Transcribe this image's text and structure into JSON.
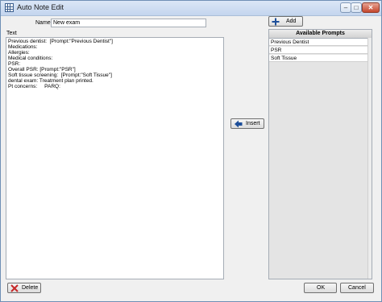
{
  "window": {
    "title": "Auto Note Edit",
    "minimize_glyph": "–",
    "maximize_glyph": "□",
    "close_glyph": "✕"
  },
  "form": {
    "name_label": "Name",
    "name_value": "New exam",
    "text_label": "Text",
    "text_lines": [
      "Previous dentist:  [Prompt:\"Previous Dentist\"]",
      "Medications:",
      "Allergies:",
      "Medical conditions:",
      "PSR:",
      "Overall PSR: [Prompt:\"PSR\"]",
      "Soft tissue screening:  [Prompt:\"Soft Tissue\"]",
      "dental exam: Treatment plan printed.",
      "Pt concerns:     PARQ:"
    ]
  },
  "buttons": {
    "add": "Add",
    "insert": "Insert",
    "delete": "Delete",
    "ok": "OK",
    "cancel": "Cancel"
  },
  "prompts": {
    "header": "Available Prompts",
    "items": [
      "Previous Dentist",
      "PSR",
      "Soft Tissue"
    ]
  },
  "colors": {
    "titlebar": "#c3d5ee",
    "add_icon": "#1e4f9a",
    "insert_icon": "#1e4f9a",
    "delete_icon": "#c62828"
  }
}
